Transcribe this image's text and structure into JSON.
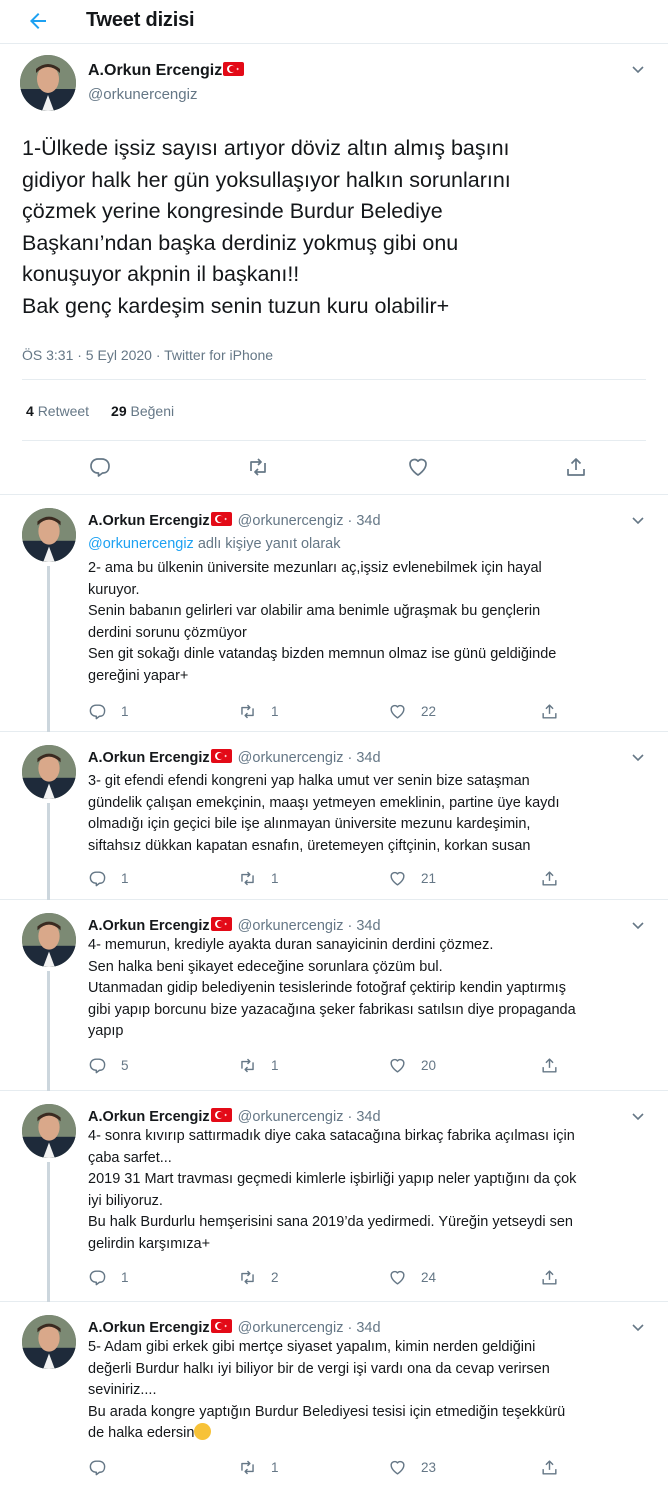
{
  "header": {
    "title": "Tweet dizisi",
    "back_icon": "arrow-left-icon"
  },
  "colors": {
    "accent": "#1da1f2",
    "muted": "#657786",
    "flag": "#e30a17"
  },
  "main_tweet": {
    "name": "A.Orkun Ercengiz",
    "handle": "@orkunercengiz",
    "text_lines": [
      "1-Ülkede işsiz sayısı artıyor döviz altın almış başını",
      "gidiyor halk her gün yoksullaşıyor halkın sorunlarını",
      "çözmek yerine kongresinde Burdur Belediye",
      "Başkanı’ndan başka derdiniz yokmuş gibi onu",
      "konuşuyor akpnin il başkanı!!",
      "Bak genç kardeşim senin tuzun kuru olabilir+"
    ],
    "meta": "ÖS 3:31 · 5 Eyl 2020 · Twitter for iPhone",
    "retweets": "4",
    "retweets_label": "Retweet",
    "likes": "29",
    "likes_label": "Beğeni"
  },
  "replies": [
    {
      "name": "A.Orkun Ercengiz",
      "meta": "@orkunercengiz · 34d",
      "reply_to_mention": "@orkunercengiz",
      "reply_to_suffix": " adlı kişiye yanıt olarak",
      "text_lines": [
        "2- ama bu ülkenin üniversite mezunları aç,işsiz evlenebilmek için hayal",
        "kuruyor.",
        "Senin babanın gelirleri var olabilir ama benimle uğraşmak bu gençlerin",
        "derdini sorunu çözmüyor",
        "Sen git sokağı dinle vatandaş bizden memnun olmaz ise günü geldiğinde",
        "gereğini yapar+"
      ],
      "comments": "1",
      "retweets": "1",
      "likes": "22"
    },
    {
      "name": "A.Orkun Ercengiz",
      "meta": "@orkunercengiz · 34d",
      "text_lines": [
        "3- git efendi efendi kongreni yap halka umut ver senin bize sataşman",
        "gündelik çalışan emekçinin, maaşı yetmeyen emeklinin, partine üye kaydı",
        "olmadığı için geçici bile işe alınmayan üniversite mezunu kardeşimin,",
        "siftahsız dükkan kapatan esnafın, üretemeyen çiftçinin, korkan susan"
      ],
      "comments": "1",
      "retweets": "1",
      "likes": "21"
    },
    {
      "name": "A.Orkun Ercengiz",
      "meta": "@orkunercengiz · 34d",
      "text_lines": [
        "4- memurun, krediyle ayakta duran sanayicinin derdini çözmez.",
        "Sen halka beni şikayet edeceğine sorunlara çözüm bul.",
        "Utanmadan gidip belediyenin tesislerinde fotoğraf çektirip kendin yaptırmış",
        "gibi yapıp borcunu bize yazacağına şeker fabrikası satılsın diye propaganda",
        "yapıp"
      ],
      "comments": "5",
      "retweets": "1",
      "likes": "20"
    },
    {
      "name": "A.Orkun Ercengiz",
      "meta": "@orkunercengiz · 34d",
      "text_lines": [
        "4- sonra kıvırıp sattırmadık diye caka satacağına birkaç fabrika açılması için",
        "çaba sarfet...",
        "2019 31 Mart travması geçmedi kimlerle işbirliği yapıp neler yaptığını da çok",
        "iyi biliyoruz.",
        "Bu halk Burdurlu hemşerisini sana 2019’da yedirmedi. Yüreğin yetseydi sen",
        "gelirdin karşımıza+"
      ],
      "comments": "1",
      "retweets": "2",
      "likes": "24"
    },
    {
      "name": "A.Orkun Ercengiz",
      "meta": "@orkunercengiz · 34d",
      "text_lines": [
        "5- Adam gibi erkek gibi mertçe siyaset yapalım, kimin nerden geldiğini",
        "değerli Burdur halkı iyi biliyor bir de vergi işi vardı ona da cevap verirsen",
        "seviniriz....",
        "Bu arada kongre yaptığın Burdur Belediyesi tesisi için etmediğin teşekkürü",
        "de halka edersin"
      ],
      "comments": "",
      "retweets": "1",
      "likes": "23"
    }
  ]
}
